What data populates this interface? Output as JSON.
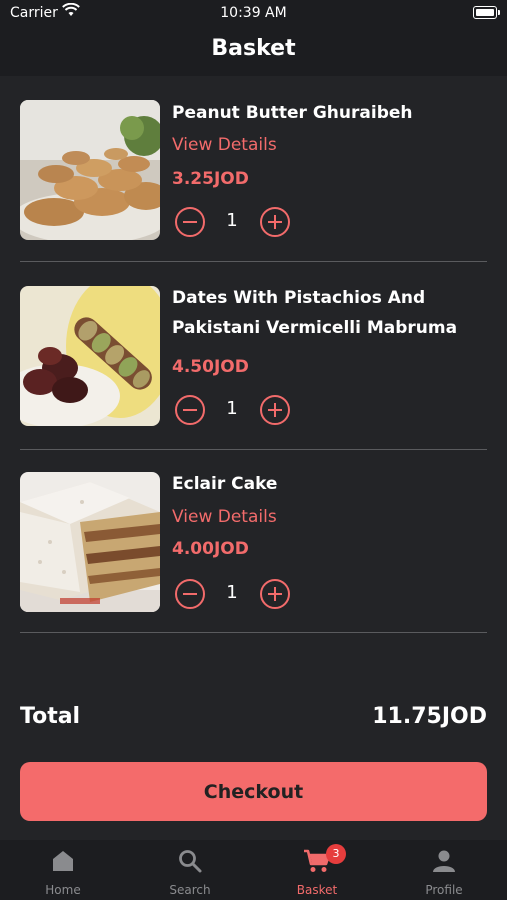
{
  "status_bar": {
    "carrier": "Carrier",
    "time": "10:39 AM"
  },
  "header": {
    "title": "Basket"
  },
  "basket": {
    "items": [
      {
        "name": "Peanut Butter Ghuraibeh",
        "details_link": "View Details",
        "price": "3.25JOD",
        "quantity": "1"
      },
      {
        "name": "Dates With Pistachios And Pakistani Vermicelli Mabruma",
        "details_link": "",
        "price": "4.50JOD",
        "quantity": "1"
      },
      {
        "name": "Eclair Cake",
        "details_link": "View Details",
        "price": "4.00JOD",
        "quantity": "1"
      }
    ]
  },
  "summary": {
    "total_label": "Total",
    "total_value": "11.75JOD",
    "checkout_label": "Checkout"
  },
  "tabs": [
    {
      "label": "Home",
      "icon": "home-icon"
    },
    {
      "label": "Search",
      "icon": "search-icon"
    },
    {
      "label": "Basket",
      "icon": "cart-icon",
      "badge": "3",
      "active": true
    },
    {
      "label": "Profile",
      "icon": "profile-icon"
    }
  ],
  "colors": {
    "accent": "#f26b6b",
    "background": "#232427",
    "bars": "#1c1d20",
    "badge": "#e63d3d"
  }
}
